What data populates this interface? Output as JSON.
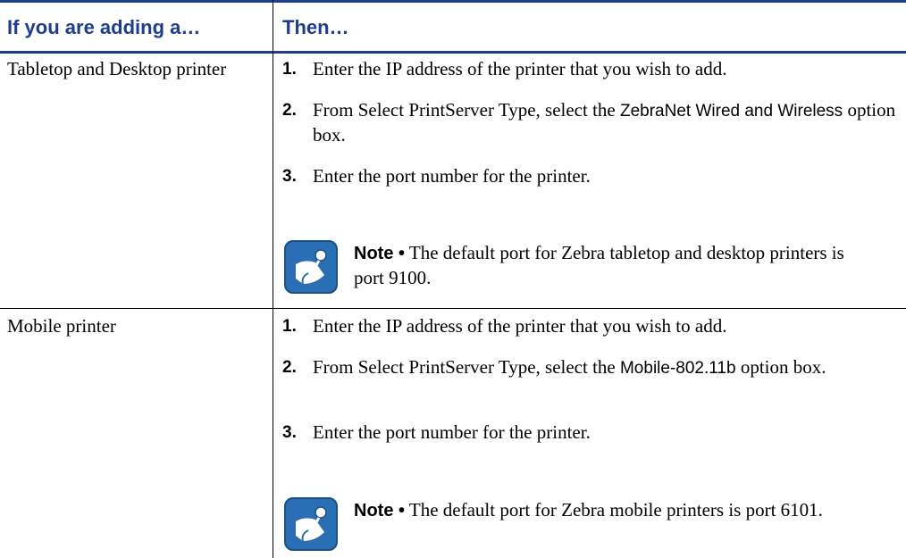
{
  "table": {
    "headers": [
      "If you are adding a…",
      "Then…"
    ],
    "rows": [
      {
        "type": "Tabletop and Desktop printer",
        "steps": [
          {
            "num": "1.",
            "parts": [
              "Enter the IP address of the printer that you wish to add."
            ]
          },
          {
            "num": "2.",
            "parts": [
              "From Select PrintServer Type, select the ",
              "ZebraNet Wired and Wireless",
              " option box."
            ]
          },
          {
            "num": "3.",
            "parts": [
              "Enter the port number for the printer."
            ]
          }
        ],
        "note": {
          "label": "Note •",
          "text": " The default port for Zebra tabletop and desktop printers is port 9100.",
          "icon": "note-pin-icon"
        }
      },
      {
        "type": "Mobile printer",
        "steps": [
          {
            "num": "1.",
            "parts": [
              "Enter the IP address of the printer that you wish to add."
            ]
          },
          {
            "num": "2.",
            "parts": [
              "From Select PrintServer Type, select the ",
              "Mobile-802.11b",
              " option box."
            ]
          },
          {
            "num": "3.",
            "parts": [
              "Enter the port number for the printer."
            ]
          }
        ],
        "note": {
          "label": "Note •",
          "text": " The default port for Zebra mobile printers is port 6101.",
          "icon": "note-pin-icon"
        }
      }
    ]
  },
  "colors": {
    "header_text": "#1e3d8f",
    "rule": "#1e3d8f",
    "icon_fill": "#2a6fb5"
  }
}
